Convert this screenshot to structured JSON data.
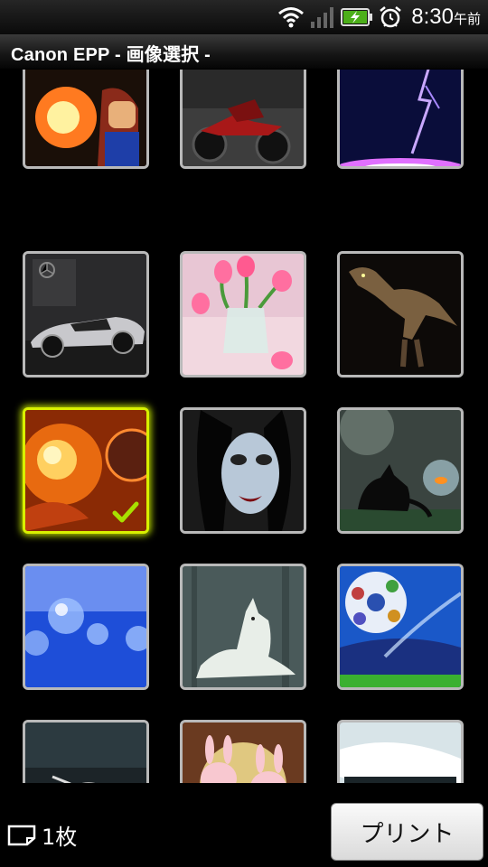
{
  "status_bar": {
    "time": "8:30",
    "ampm": "午前"
  },
  "title_bar": {
    "title": "Canon EPP  - 画像選択 -"
  },
  "grid": {
    "tiles": [
      {
        "name": "image-tile-mario",
        "subject": "fire fighter character",
        "selected": false
      },
      {
        "name": "image-tile-motorcycles",
        "subject": "motorcycles",
        "selected": false
      },
      {
        "name": "image-tile-lightning",
        "subject": "lightning",
        "selected": false
      },
      {
        "name": "image-tile-mercedes",
        "subject": "silver sports car",
        "selected": false
      },
      {
        "name": "image-tile-tulips",
        "subject": "pink tulips",
        "selected": false
      },
      {
        "name": "image-tile-dinosaur",
        "subject": "dinosaur",
        "selected": false
      },
      {
        "name": "image-tile-fire-planet",
        "subject": "fire planet",
        "selected": true
      },
      {
        "name": "image-tile-vampire",
        "subject": "vampire face",
        "selected": false
      },
      {
        "name": "image-tile-cat-fishbowl",
        "subject": "cat and fishbowl",
        "selected": false
      },
      {
        "name": "image-tile-water-drops",
        "subject": "blue water drops",
        "selected": false
      },
      {
        "name": "image-tile-white-wolf",
        "subject": "white wolf",
        "selected": false
      },
      {
        "name": "image-tile-soccer-ball",
        "subject": "soccer ball",
        "selected": false
      },
      {
        "name": "image-tile-chopper",
        "subject": "chrome motorcycle",
        "selected": false
      },
      {
        "name": "image-tile-bunnies",
        "subject": "pink bunnies",
        "selected": false
      },
      {
        "name": "image-tile-screen",
        "subject": "screen capture",
        "selected": false
      }
    ]
  },
  "bottom_bar": {
    "count_label": "1枚",
    "print_label": "プリント"
  },
  "colors": {
    "selection": "#d9f000",
    "check": "#a8e000"
  }
}
